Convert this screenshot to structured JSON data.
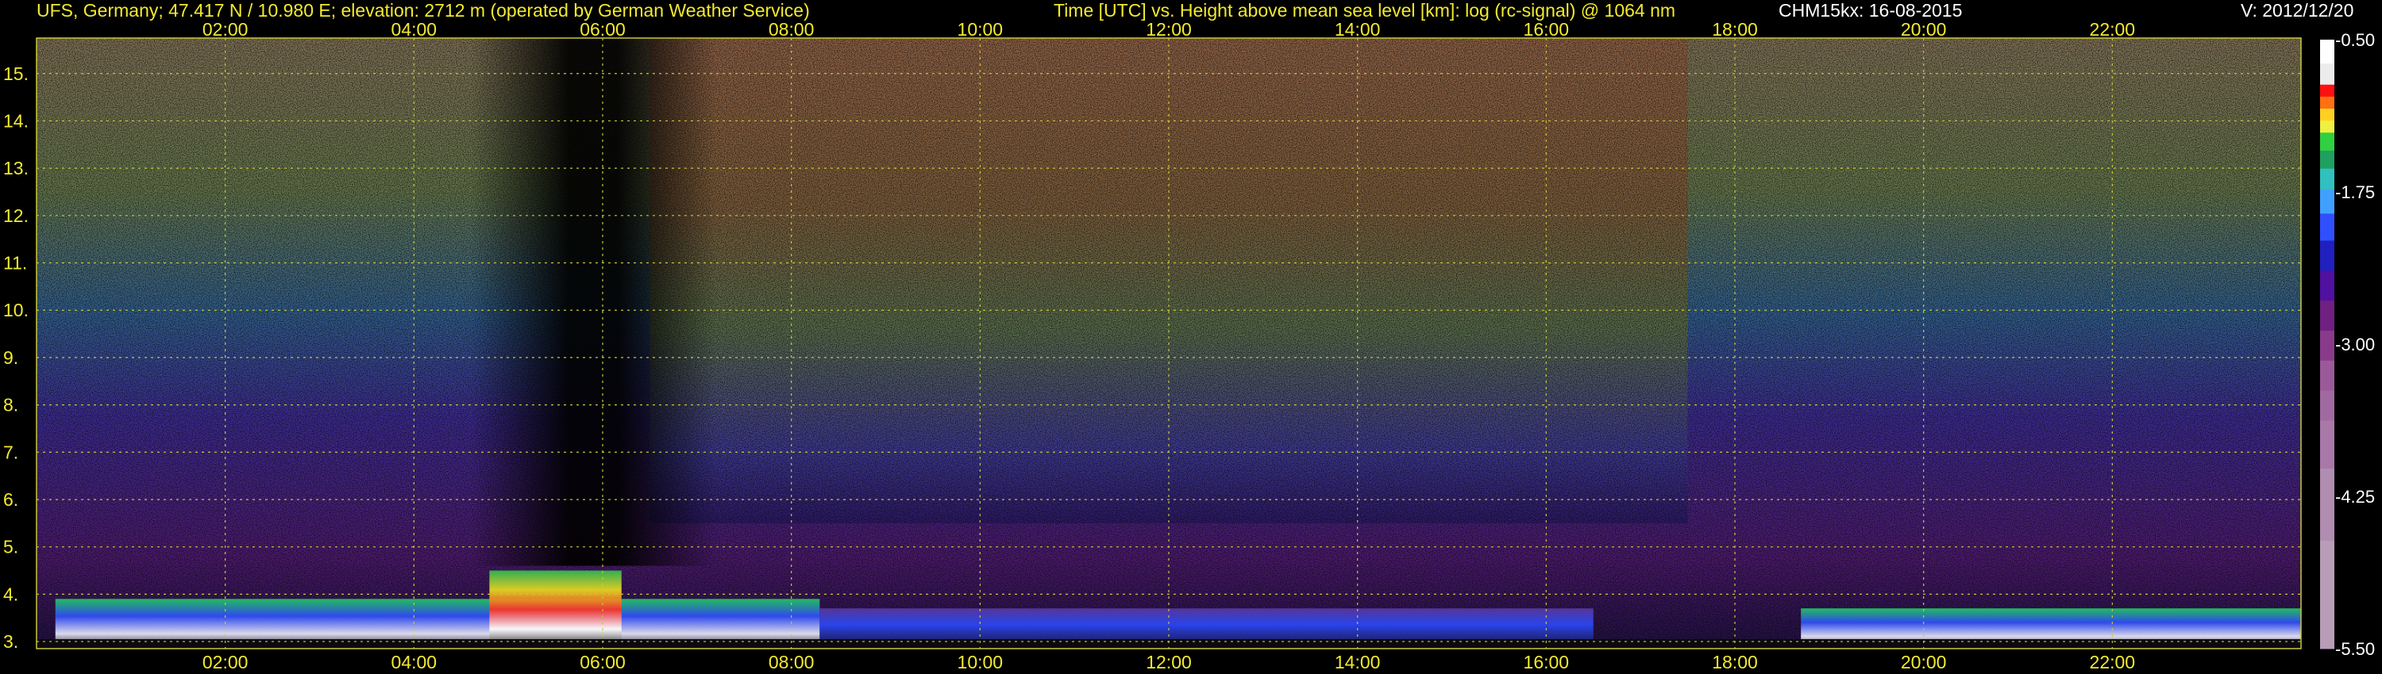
{
  "header": {
    "station": "UFS, Germany; 47.417 N / 10.980 E; elevation: 2712 m  (operated by German Weather Service)",
    "title": "Time [UTC] vs. Height above mean sea level [km]: log (rc-signal) @ 1064 nm",
    "instrument_date": "CHM15kx: 16-08-2015",
    "version": "V: 2012/12/20"
  },
  "colors": {
    "axis_text": "#f2ea2e",
    "grid": "#c8c83a",
    "background": "#000000"
  },
  "chart_data": {
    "type": "heatmap",
    "title": "Time [UTC] vs. Height above mean sea level [km]: log (rc-signal) @ 1064 nm",
    "xlabel": "",
    "ylabel": "",
    "x_unit": "UTC hours",
    "xlim": [
      0,
      24
    ],
    "x_ticks": [
      2,
      4,
      6,
      8,
      10,
      12,
      14,
      16,
      18,
      20,
      22
    ],
    "x_tick_labels": [
      "02:00",
      "04:00",
      "06:00",
      "08:00",
      "10:00",
      "12:00",
      "14:00",
      "16:00",
      "18:00",
      "20:00",
      "22:00"
    ],
    "ylim": [
      2.85,
      15.75
    ],
    "y_ticks": [
      3,
      4,
      5,
      6,
      7,
      8,
      9,
      10,
      11,
      12,
      13,
      14,
      15
    ],
    "y_tick_labels": [
      "3.",
      "4.",
      "5.",
      "6.",
      "7.",
      "8.",
      "9.",
      "10.",
      "11.",
      "12.",
      "13.",
      "14.",
      "15."
    ],
    "grid": true,
    "colorbar": {
      "min": -5.5,
      "max": -0.5,
      "tick_values": [
        -0.5,
        -1.75,
        -3.0,
        -4.25,
        -5.5
      ],
      "tick_labels": [
        "-0.50",
        "-1.75",
        "-3.00",
        "-4.25",
        "-5.50"
      ]
    },
    "features": [
      {
        "kind": "boundary_layer",
        "t_start": 0.2,
        "t_end": 8.3,
        "top_km": 3.9
      },
      {
        "kind": "aerosol_plume",
        "t_start": 4.8,
        "t_end": 6.2,
        "top_km": 4.5
      },
      {
        "kind": "aerosol_layer",
        "t_start": 8.3,
        "t_end": 16.5,
        "top_km": 3.7
      },
      {
        "kind": "boundary_layer",
        "t_start": 18.7,
        "t_end": 24.0,
        "top_km": 3.7
      },
      {
        "kind": "low_signal_band",
        "t_start": 4.6,
        "t_end": 7.2,
        "top_km": 15.75
      }
    ]
  }
}
